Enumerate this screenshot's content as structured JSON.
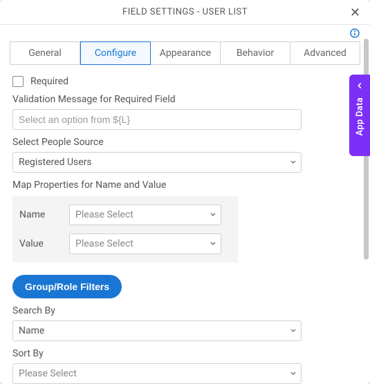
{
  "header": {
    "title": "FIELD SETTINGS - USER LIST"
  },
  "tabs": {
    "general": "General",
    "configure": "Configure",
    "appearance": "Appearance",
    "behavior": "Behavior",
    "advanced": "Advanced"
  },
  "form": {
    "required_label": "Required",
    "validation_label": "Validation Message for Required Field",
    "validation_placeholder": "Select an option from ${L}",
    "people_source_label": "Select People Source",
    "people_source_value": "Registered Users",
    "map_label": "Map Properties for Name and Value",
    "map_name_label": "Name",
    "map_name_value": "Please Select",
    "map_value_label": "Value",
    "map_value_value": "Please Select",
    "group_filters_btn": "Group/Role Filters",
    "search_by_label": "Search By",
    "search_by_value": "Name",
    "sort_by_label": "Sort By",
    "sort_by_value": "Please Select"
  },
  "side_tab": {
    "label": "App Data"
  }
}
